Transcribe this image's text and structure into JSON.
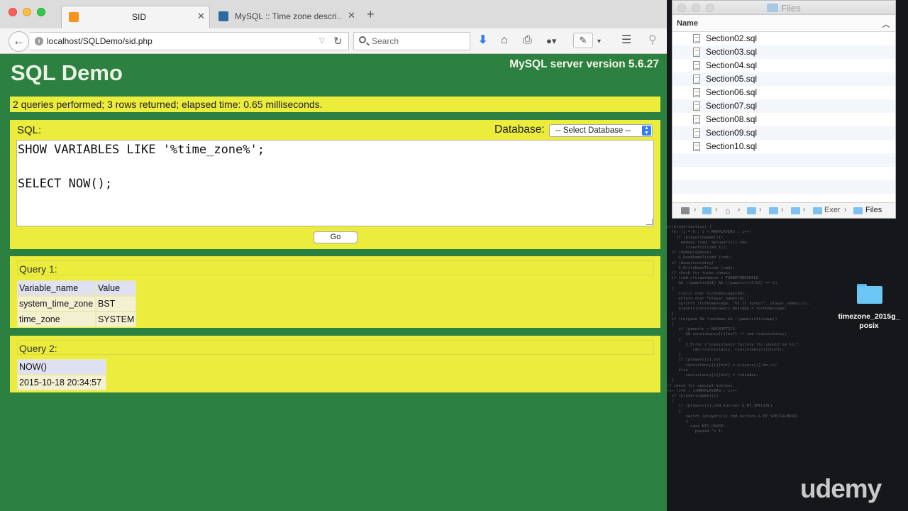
{
  "browser": {
    "tabs": [
      {
        "title": "SID",
        "active": true
      },
      {
        "title": "MySQL :: Time zone descri...",
        "active": false
      }
    ],
    "url": "localhost/SQLDemo/sid.php",
    "search_placeholder": "Search"
  },
  "page": {
    "title": "SQL Demo",
    "server_version": "MySQL server version 5.6.27",
    "status": "2 queries performed; 3 rows returned; elapsed time: 0.65 milliseconds.",
    "sql_label": "SQL:",
    "database_label": "Database:",
    "database_select": "-- Select Database --",
    "sql_text": "SHOW VARIABLES LIKE '%time_zone%';\n\nSELECT NOW();",
    "go_label": "Go",
    "queries": [
      {
        "label": "Query 1:",
        "columns": [
          "Variable_name",
          "Value"
        ],
        "rows": [
          [
            "system_time_zone",
            "BST"
          ],
          [
            "time_zone",
            "SYSTEM"
          ]
        ]
      },
      {
        "label": "Query 2:",
        "columns": [
          "NOW()"
        ],
        "rows": [
          [
            "2015-10-18 20:34:57"
          ]
        ]
      }
    ]
  },
  "finder": {
    "title": "Files",
    "column_name": "Name",
    "files": [
      "Section02.sql",
      "Section03.sql",
      "Section04.sql",
      "Section05.sql",
      "Section06.sql",
      "Section07.sql",
      "Section08.sql",
      "Section09.sql",
      "Section10.sql"
    ],
    "path": [
      "Exer",
      "Files"
    ]
  },
  "desktop": {
    "folder_label": "timezone_2015g_ posix",
    "watermark": "udemy"
  },
  "colors": {
    "page_bg": "#2c8040",
    "panel_bg": "#ebec3b",
    "table_header": "#dfe0f2",
    "table_row": "#f4f0d2"
  }
}
